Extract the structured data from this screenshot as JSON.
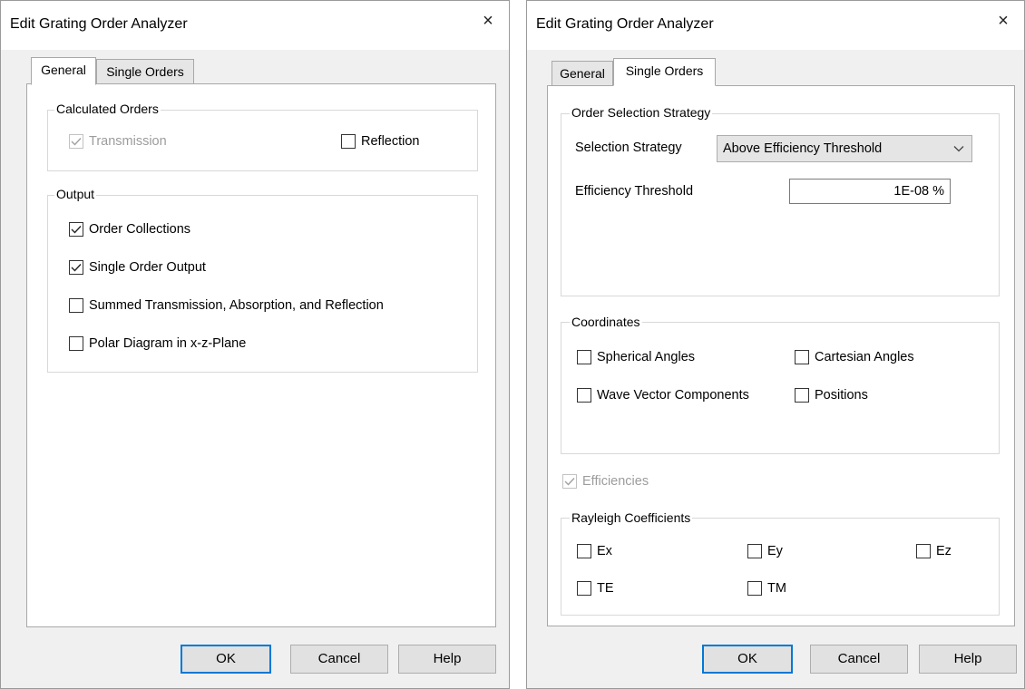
{
  "left_dialog": {
    "title": "Edit Grating Order Analyzer",
    "close_glyph": "×",
    "tabs": [
      {
        "label": "General",
        "active": true
      },
      {
        "label": "Single Orders",
        "active": false
      }
    ],
    "calculated_orders": {
      "label": "Calculated Orders",
      "transmission": {
        "label": "Transmission",
        "checked": true,
        "enabled": false
      },
      "reflection": {
        "label": "Reflection",
        "checked": false,
        "enabled": true
      }
    },
    "output": {
      "label": "Output",
      "items": [
        {
          "label": "Order Collections",
          "checked": true
        },
        {
          "label": "Single Order Output",
          "checked": true
        },
        {
          "label": "Summed Transmission, Absorption, and Reflection",
          "checked": false
        },
        {
          "label": "Polar Diagram in x-z-Plane",
          "checked": false
        }
      ]
    },
    "buttons": {
      "ok": "OK",
      "cancel": "Cancel",
      "help": "Help"
    }
  },
  "right_dialog": {
    "title": "Edit Grating Order Analyzer",
    "close_glyph": "×",
    "tabs": [
      {
        "label": "General",
        "active": false
      },
      {
        "label": "Single Orders",
        "active": true
      }
    ],
    "order_selection": {
      "label": "Order Selection Strategy",
      "strategy_label": "Selection Strategy",
      "strategy_value": "Above Efficiency Threshold",
      "threshold_label": "Efficiency Threshold",
      "threshold_value": "1E-08 %"
    },
    "coordinates": {
      "label": "Coordinates",
      "spherical": {
        "label": "Spherical Angles",
        "checked": false
      },
      "cartesian": {
        "label": "Cartesian Angles",
        "checked": false
      },
      "wave_vector": {
        "label": "Wave Vector Components",
        "checked": false
      },
      "positions": {
        "label": "Positions",
        "checked": false
      }
    },
    "efficiencies": {
      "label": "Efficiencies",
      "checked": true,
      "enabled": false
    },
    "rayleigh": {
      "label": "Rayleigh Coefficients",
      "ex": {
        "label": "Ex",
        "checked": false
      },
      "ey": {
        "label": "Ey",
        "checked": false
      },
      "ez": {
        "label": "Ez",
        "checked": false
      },
      "te": {
        "label": "TE",
        "checked": false
      },
      "tm": {
        "label": "TM",
        "checked": false
      }
    },
    "buttons": {
      "ok": "OK",
      "cancel": "Cancel",
      "help": "Help"
    }
  },
  "colors": {
    "dialog_bg": "#f0f0f0",
    "panel_bg": "#ffffff",
    "default_button_border": "#0078d7",
    "disabled_text": "#9c9c9c"
  }
}
